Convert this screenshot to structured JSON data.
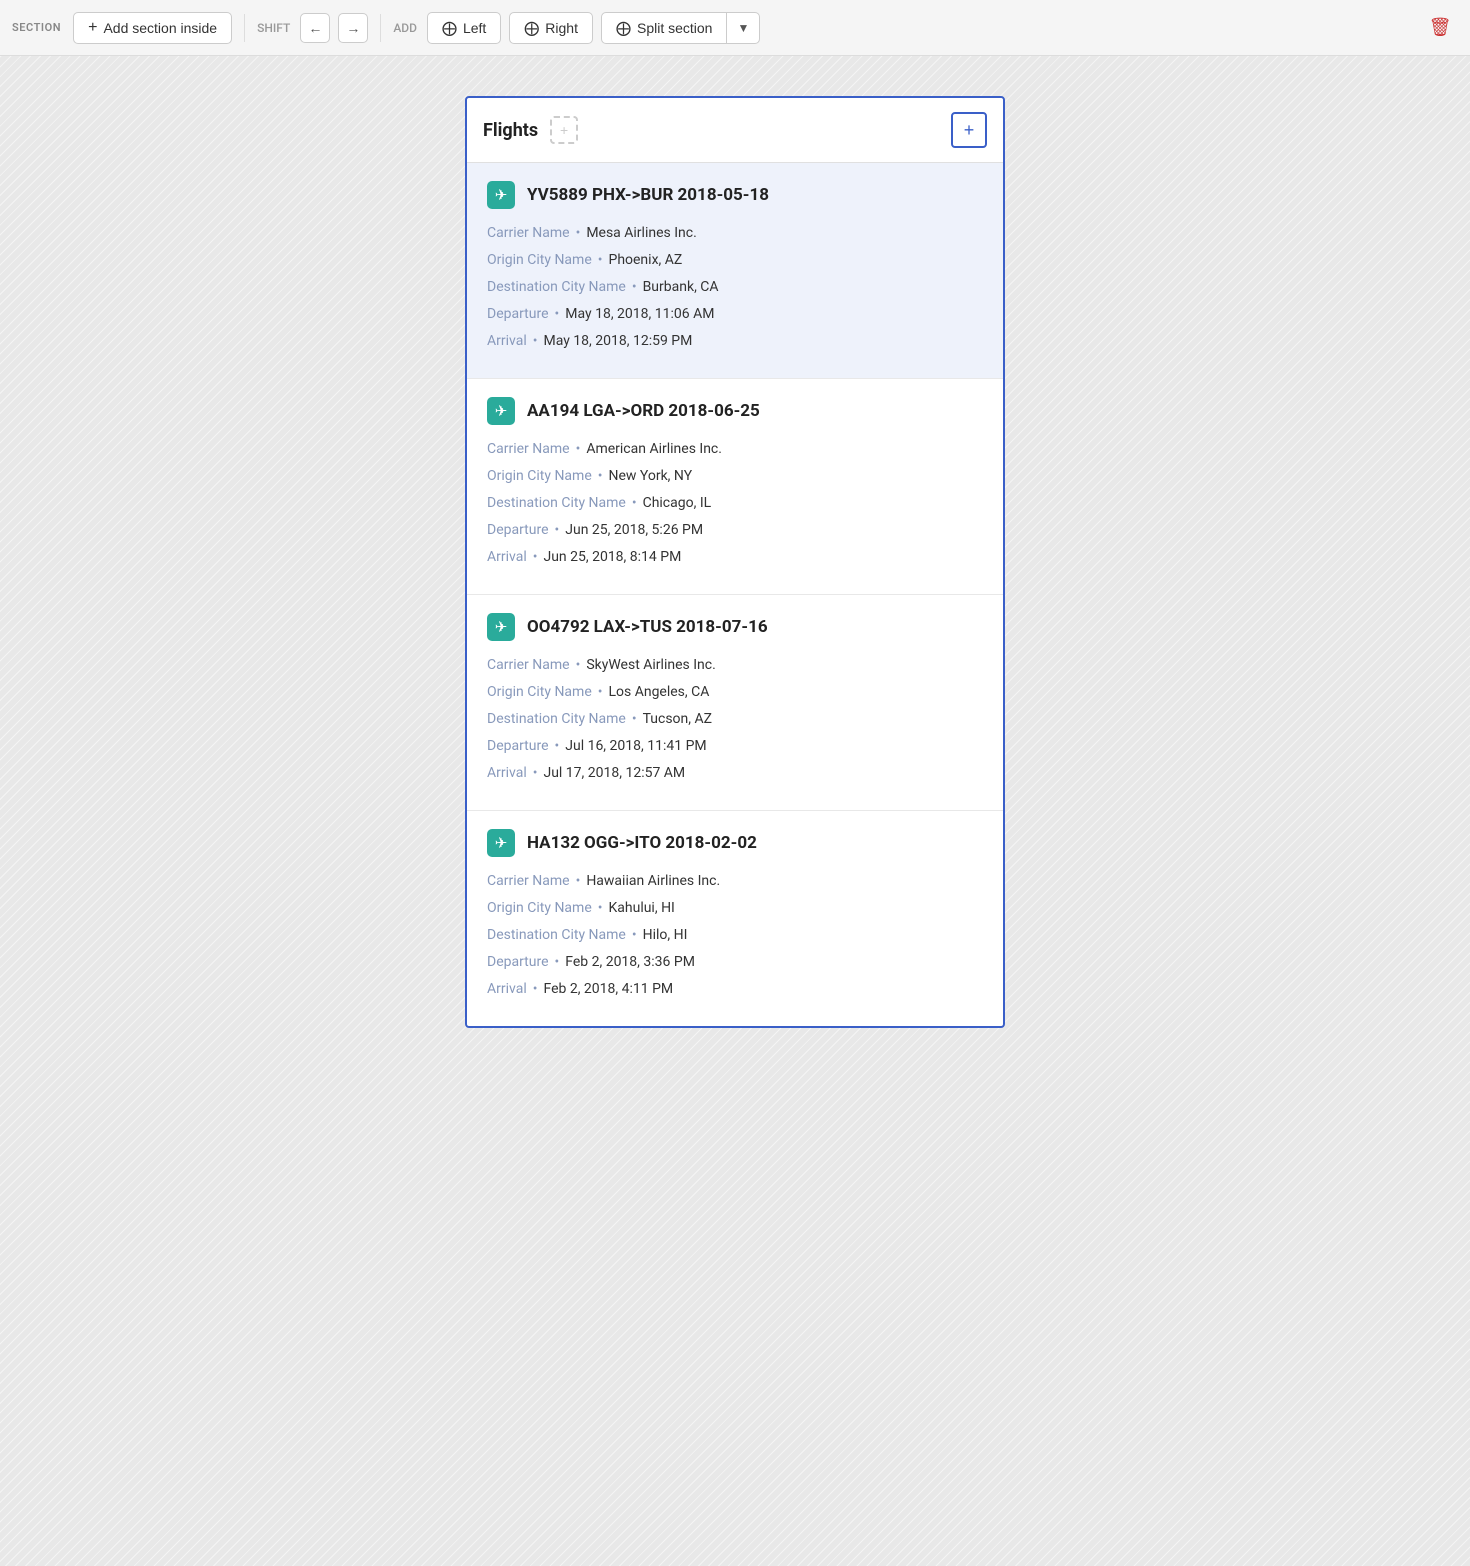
{
  "toolbar": {
    "section_label": "SECTION",
    "add_section_label": "Add section inside",
    "shift_label": "SHIFT",
    "add_label": "ADD",
    "left_label": "Left",
    "right_label": "Right",
    "split_label": "Split section",
    "left_icon": "⊞",
    "right_icon": "⊞"
  },
  "section": {
    "title": "Flights",
    "add_column_placeholder": "+",
    "add_column_active": "+"
  },
  "flights": [
    {
      "id": "flight-1",
      "title": "YV5889 PHX->BUR 2018-05-18",
      "selected": true,
      "fields": [
        {
          "label": "Carrier Name",
          "value": "Mesa Airlines Inc."
        },
        {
          "label": "Origin City Name",
          "value": "Phoenix, AZ"
        },
        {
          "label": "Destination City Name",
          "value": "Burbank, CA"
        },
        {
          "label": "Departure",
          "value": "May 18, 2018, 11:06 AM"
        },
        {
          "label": "Arrival",
          "value": "May 18, 2018, 12:59 PM"
        }
      ]
    },
    {
      "id": "flight-2",
      "title": "AA194 LGA->ORD 2018-06-25",
      "selected": false,
      "fields": [
        {
          "label": "Carrier Name",
          "value": "American Airlines Inc."
        },
        {
          "label": "Origin City Name",
          "value": "New York, NY"
        },
        {
          "label": "Destination City Name",
          "value": "Chicago, IL"
        },
        {
          "label": "Departure",
          "value": "Jun 25, 2018, 5:26 PM"
        },
        {
          "label": "Arrival",
          "value": "Jun 25, 2018, 8:14 PM"
        }
      ]
    },
    {
      "id": "flight-3",
      "title": "OO4792 LAX->TUS 2018-07-16",
      "selected": false,
      "fields": [
        {
          "label": "Carrier Name",
          "value": "SkyWest Airlines Inc."
        },
        {
          "label": "Origin City Name",
          "value": "Los Angeles, CA"
        },
        {
          "label": "Destination City Name",
          "value": "Tucson, AZ"
        },
        {
          "label": "Departure",
          "value": "Jul 16, 2018, 11:41 PM"
        },
        {
          "label": "Arrival",
          "value": "Jul 17, 2018, 12:57 AM"
        }
      ]
    },
    {
      "id": "flight-4",
      "title": "HA132 OGG->ITO 2018-02-02",
      "selected": false,
      "fields": [
        {
          "label": "Carrier Name",
          "value": "Hawaiian Airlines Inc."
        },
        {
          "label": "Origin City Name",
          "value": "Kahului, HI"
        },
        {
          "label": "Destination City Name",
          "value": "Hilo, HI"
        },
        {
          "label": "Departure",
          "value": "Feb 2, 2018, 3:36 PM"
        },
        {
          "label": "Arrival",
          "value": "Feb 2, 2018, 4:11 PM"
        }
      ]
    }
  ]
}
